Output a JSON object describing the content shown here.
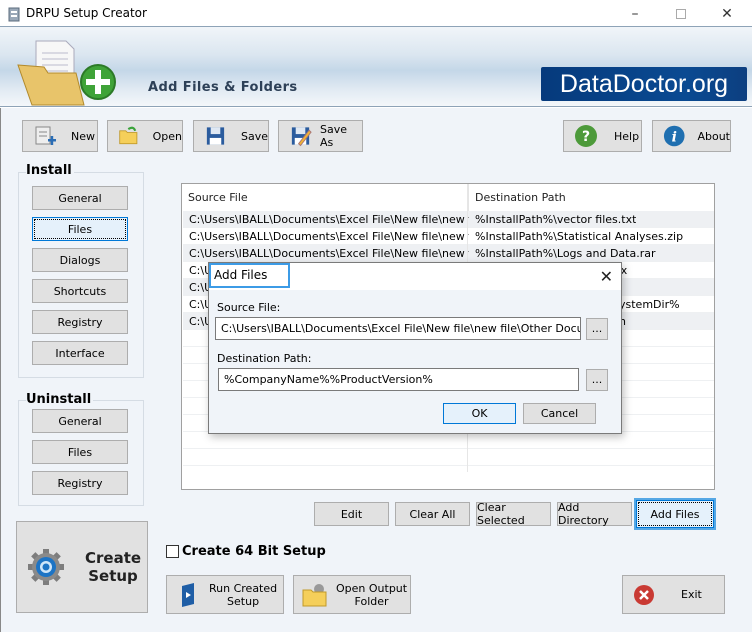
{
  "window": {
    "title": "DRPU Setup Creator",
    "controls": [
      "minimize",
      "maximize",
      "close"
    ]
  },
  "header": {
    "heading": "Add Files & Folders",
    "brand": "DataDoctor.org",
    "icon": "folder-add-icon"
  },
  "toolbar": {
    "new_label": "New",
    "open_label": "Open",
    "save_label": "Save",
    "save_as_label": "Save As",
    "help_label": "Help",
    "about_label": "About"
  },
  "sidebar": {
    "install_title": "Install",
    "install_items": [
      "General",
      "Files",
      "Dialogs",
      "Shortcuts",
      "Registry",
      "Interface"
    ],
    "install_selected": "Files",
    "uninstall_title": "Uninstall",
    "uninstall_items": [
      "General",
      "Files",
      "Registry"
    ],
    "create_setup_line1": "Create",
    "create_setup_line2": "Setup"
  },
  "file_list": {
    "columns": [
      "Source File",
      "Destination Path"
    ],
    "rows": [
      {
        "source": "C:\\Users\\IBALL\\Documents\\Excel File\\New file\\new file\\...",
        "dest": "%InstallPath%\\vector files.txt"
      },
      {
        "source": "C:\\Users\\IBALL\\Documents\\Excel File\\New file\\new file\\...",
        "dest": "%InstallPath%\\Statistical Analyses.zip"
      },
      {
        "source": "C:\\Users\\IBALL\\Documents\\Excel File\\New file\\new file\\...",
        "dest": "%InstallPath%\\Logs and Data.rar"
      },
      {
        "source": "C:\\U",
        "dest": "sx"
      },
      {
        "source": "C:\\U",
        "dest": "e"
      },
      {
        "source": "C:\\U",
        "dest": "ystemDir%"
      },
      {
        "source": "C:\\U",
        "dest": "n"
      }
    ]
  },
  "list_actions": {
    "edit": "Edit",
    "clear_all": "Clear All",
    "clear_selected": "Clear Selected",
    "add_directory": "Add Directory",
    "add_files": "Add Files"
  },
  "options": {
    "create_64bit_label": "Create 64 Bit Setup",
    "create_64bit_checked": false
  },
  "bottom": {
    "run_setup_line1": "Run Created",
    "run_setup_line2": "Setup",
    "open_output_line1": "Open Output",
    "open_output_line2": "Folder",
    "exit_label": "Exit"
  },
  "dialog": {
    "title": "Add Files",
    "source_label": "Source File:",
    "source_value": "C:\\Users\\IBALL\\Documents\\Excel File\\New file\\new file\\Other Document\\vector files.txt",
    "dest_label": "Destination Path:",
    "dest_value": "%CompanyName%%ProductVersion%",
    "browse_label": "...",
    "ok_label": "OK",
    "cancel_label": "Cancel"
  }
}
